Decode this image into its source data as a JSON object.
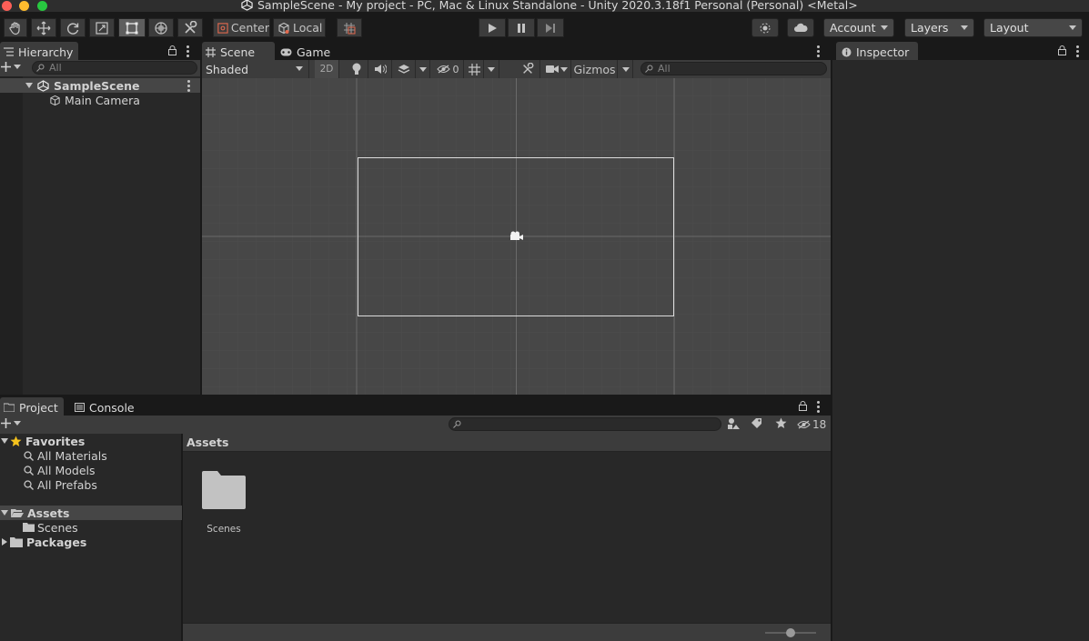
{
  "window": {
    "title": "SampleScene - My project - PC, Mac & Linux Standalone - Unity 2020.3.18f1 Personal (Personal) <Metal>"
  },
  "toolbar": {
    "tools": [
      "hand-tool",
      "move-tool",
      "rotate-tool",
      "scale-tool",
      "rect-tool",
      "transform-tool",
      "custom-editor-tool"
    ],
    "active_tool": "rect-tool",
    "pivot_label": "Center",
    "space_label": "Local",
    "account_label": "Account",
    "layers_label": "Layers",
    "layout_label": "Layout"
  },
  "hierarchy": {
    "tab_label": "Hierarchy",
    "search_placeholder": "All",
    "scene_name": "SampleScene",
    "items": [
      "Main Camera"
    ]
  },
  "scene_view": {
    "tabs": [
      "Scene",
      "Game"
    ],
    "shading_mode": "Shaded",
    "mode_2d_label": "2D",
    "hidden_count": "0",
    "gizmos_label": "Gizmos",
    "search_placeholder": "All"
  },
  "inspector": {
    "tab_label": "Inspector"
  },
  "project": {
    "tabs": [
      "Project",
      "Console"
    ],
    "hidden_count": "18",
    "favorites_label": "Favorites",
    "favorites": [
      "All Materials",
      "All Models",
      "All Prefabs"
    ],
    "assets_label": "Assets",
    "assets_children": [
      "Scenes"
    ],
    "packages_label": "Packages",
    "breadcrumb": "Assets",
    "grid_items": [
      "Scenes"
    ],
    "zoom_level": 0.5
  },
  "colors": {
    "accent_play": "#c4c4c4",
    "selection": "#4c4c4c",
    "scene_bg": "#474747",
    "grid_line": "#555555",
    "star": "#f4c21d"
  }
}
